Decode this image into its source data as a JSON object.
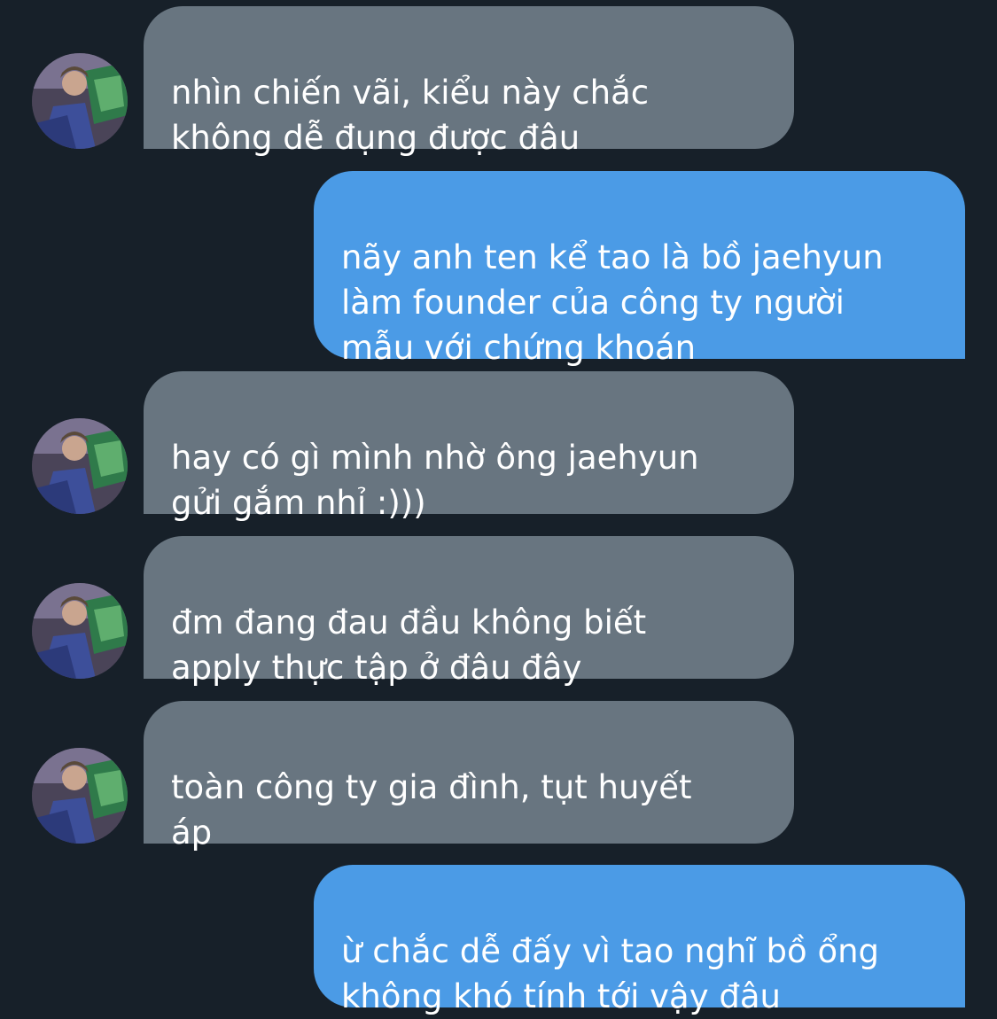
{
  "conversation": {
    "messages": [
      {
        "direction": "incoming",
        "text": "nhìn chiến vãi, kiểu này chắc\nkhông dễ đụng được đâu",
        "avatar_icon": "contact-photo-icon"
      },
      {
        "direction": "outgoing",
        "text": "nãy anh ten kể tao là bồ jaehyun\nlàm founder của công ty người\nmẫu với chứng khoán"
      },
      {
        "direction": "incoming",
        "text": "hay có gì mình nhờ ông jaehyun\ngửi gắm nhỉ :)))",
        "avatar_icon": "contact-photo-icon"
      },
      {
        "direction": "incoming",
        "text": "đm đang đau đầu không biết\napply thực tập ở đâu đây",
        "avatar_icon": "contact-photo-icon"
      },
      {
        "direction": "incoming",
        "text": "toàn công ty gia đình, tụt huyết\náp",
        "avatar_icon": "contact-photo-icon"
      },
      {
        "direction": "outgoing",
        "text": "ừ chắc dễ đấy vì tao nghĩ bồ ổng\nkhông khó tính tới vậy đâu"
      }
    ]
  },
  "colors": {
    "background": "#172029",
    "incoming_bubble": "#687580",
    "outgoing_bubble": "#4b9be6",
    "text": "#ffffff"
  }
}
